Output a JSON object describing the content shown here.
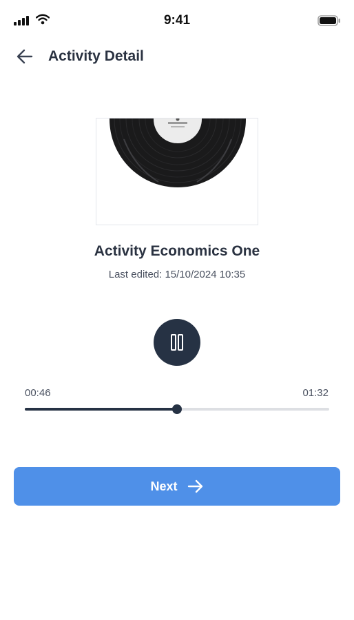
{
  "status_bar": {
    "time": "9:41"
  },
  "header": {
    "title": "Activity Detail"
  },
  "activity": {
    "title": "Activity Economics One",
    "last_edited": "Last edited: 15/10/2024 10:35"
  },
  "player": {
    "current_time": "00:46",
    "total_time": "01:32",
    "progress_fraction": 0.5,
    "state": "playing",
    "control_icon": "pause-icon"
  },
  "actions": {
    "next_label": "Next"
  },
  "colors": {
    "text_primary": "#2a3241",
    "player_dark": "#263244",
    "track": "#dddfe3",
    "accent": "#4f90e8"
  }
}
